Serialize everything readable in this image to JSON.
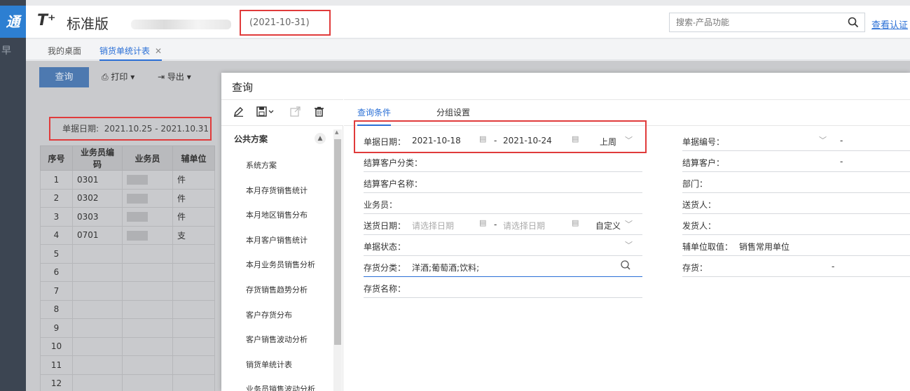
{
  "app": {
    "logo_glyph": "通",
    "nav_glyph": "早",
    "brand_mark": "T⁺",
    "brand_edition": "标准版",
    "system_date": "(2021-10-31)",
    "search_placeholder": "搜索-产品功能",
    "verify_link": "查看认证"
  },
  "tabs": {
    "home": "我的桌面",
    "active": "销货单统计表"
  },
  "report": {
    "query_button": "查询",
    "toolbar": [
      "打印",
      "导出"
    ],
    "date_range_label": "单据日期:",
    "date_range_value": "2021.10.25 - 2021.10.31",
    "columns": [
      "序号",
      "业务员编码",
      "业务员",
      "辅单位"
    ],
    "rows": [
      {
        "no": "1",
        "code": "0301",
        "unit": "件"
      },
      {
        "no": "2",
        "code": "0302",
        "unit": "件"
      },
      {
        "no": "3",
        "code": "0303",
        "unit": "件"
      },
      {
        "no": "4",
        "code": "0701",
        "unit": "支"
      },
      {
        "no": "5",
        "code": "",
        "unit": ""
      },
      {
        "no": "6",
        "code": "",
        "unit": ""
      },
      {
        "no": "7",
        "code": "",
        "unit": ""
      },
      {
        "no": "8",
        "code": "",
        "unit": ""
      },
      {
        "no": "9",
        "code": "",
        "unit": ""
      },
      {
        "no": "10",
        "code": "",
        "unit": ""
      },
      {
        "no": "11",
        "code": "",
        "unit": ""
      },
      {
        "no": "12",
        "code": "",
        "unit": ""
      }
    ]
  },
  "modal": {
    "title": "查询",
    "scheme_header": "公共方案",
    "schemes": [
      "系统方案",
      "本月存货销售统计",
      "本月地区销售分布",
      "本月客户销售统计",
      "本月业务员销售分析",
      "存货销售趋势分析",
      "客户存货分布",
      "客户销售波动分析",
      "销货单统计表",
      "业务员销售波动分析"
    ],
    "tab_conditions": "查询条件",
    "tab_grouping": "分组设置",
    "fields_left": {
      "doc_date": {
        "label": "单据日期：",
        "from": "2021-10-18",
        "to": "2021-10-24",
        "preset": "上周"
      },
      "cust_category": {
        "label": "结算客户分类："
      },
      "cust_name": {
        "label": "结算客户名称："
      },
      "salesman": {
        "label": "业务员："
      },
      "delivery_date": {
        "label": "送货日期：",
        "from_ph": "请选择日期",
        "to_ph": "请选择日期",
        "preset": "自定义"
      },
      "doc_status": {
        "label": "单据状态："
      },
      "inventory_category": {
        "label": "存货分类：",
        "value": "洋酒;葡萄酒;饮料;"
      },
      "inventory_name": {
        "label": "存货名称："
      }
    },
    "fields_right": {
      "doc_no": {
        "label": "单据编号：",
        "dash": "-"
      },
      "settle_customer": {
        "label": "结算客户：",
        "dash": "-"
      },
      "department": {
        "label": "部门："
      },
      "delivery_person": {
        "label": "送货人："
      },
      "shipper": {
        "label": "发货人："
      },
      "aux_unit": {
        "label": "辅单位取值：",
        "value": "销售常用单位"
      },
      "inventory": {
        "label": "存货：",
        "dash": "-"
      }
    },
    "separator": "-"
  }
}
